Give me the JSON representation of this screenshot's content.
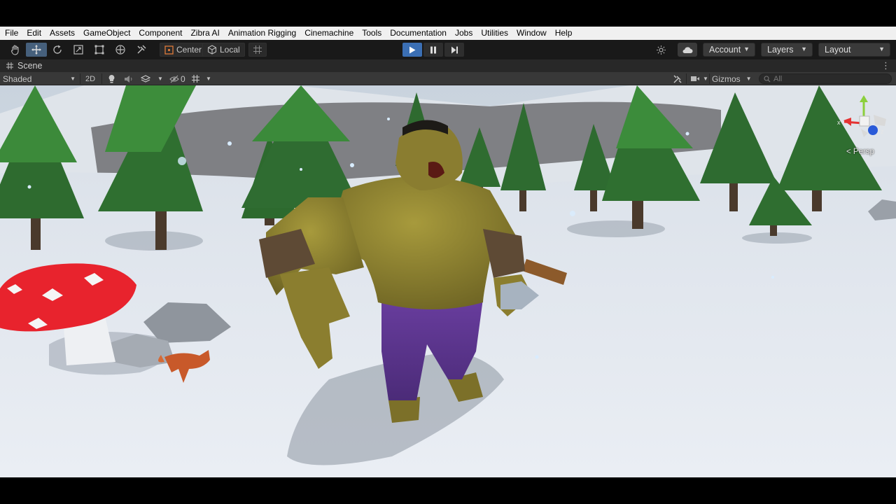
{
  "menu": [
    "File",
    "Edit",
    "Assets",
    "GameObject",
    "Component",
    "Zibra AI",
    "Animation Rigging",
    "Cinemachine",
    "Tools",
    "Documentation",
    "Jobs",
    "Utilities",
    "Window",
    "Help"
  ],
  "toolbar": {
    "tools": [
      "hand-tool-icon",
      "move-tool-icon",
      "rotate-tool-icon",
      "scale-tool-icon",
      "rect-tool-icon",
      "transform-tool-icon",
      "custom-tool-icon"
    ],
    "pivot_mode": "Center",
    "pivot_rotation": "Local",
    "account_label": "Account",
    "layers_label": "Layers",
    "layout_label": "Layout"
  },
  "scene_tab": {
    "label": "Scene"
  },
  "scene_toolbar": {
    "draw_mode": "Shaded",
    "mode_2d": "2D",
    "hidden_count": "0",
    "gizmos_label": "Gizmos",
    "search_placeholder": "All"
  },
  "viewport": {
    "gizmo_axes": {
      "x": "x",
      "y": "y",
      "z": "z"
    },
    "projection": "< Persp"
  },
  "colors": {
    "accent_play": "#3b6fb4",
    "active_tool": "#46607c",
    "menu_bg": "#f0f0f0",
    "toolbar_bg": "#191919",
    "snow": "#e4e8ef",
    "mushroom_red": "#e8232d"
  }
}
